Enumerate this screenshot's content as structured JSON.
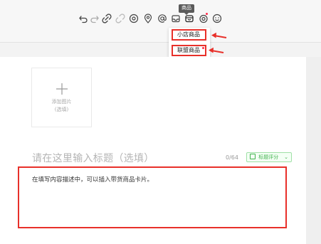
{
  "toolbar": {
    "tooltip": "商品",
    "icons": [
      "undo-icon",
      "redo-icon",
      "link-icon",
      "unlink-icon",
      "at-circle-icon",
      "location-icon",
      "at-icon",
      "inbox-icon",
      "product-icon",
      "target-icon",
      "emoji-icon"
    ]
  },
  "product_menu": {
    "items": [
      {
        "label": "小店商品"
      },
      {
        "label": "联盟商品"
      }
    ]
  },
  "upload": {
    "line1": "添加图片",
    "line2": "(选填)"
  },
  "title_field": {
    "placeholder": "请在这里输入标题（选填）",
    "counter": "0/64"
  },
  "score_button": {
    "label": "标题评分"
  },
  "content": {
    "placeholder": "在填写内容描述中，可以插入带货商品卡片。"
  },
  "colors": {
    "highlight": "#e8302a",
    "green": "#3fb24c",
    "badge_red": "#ff2e4d"
  }
}
